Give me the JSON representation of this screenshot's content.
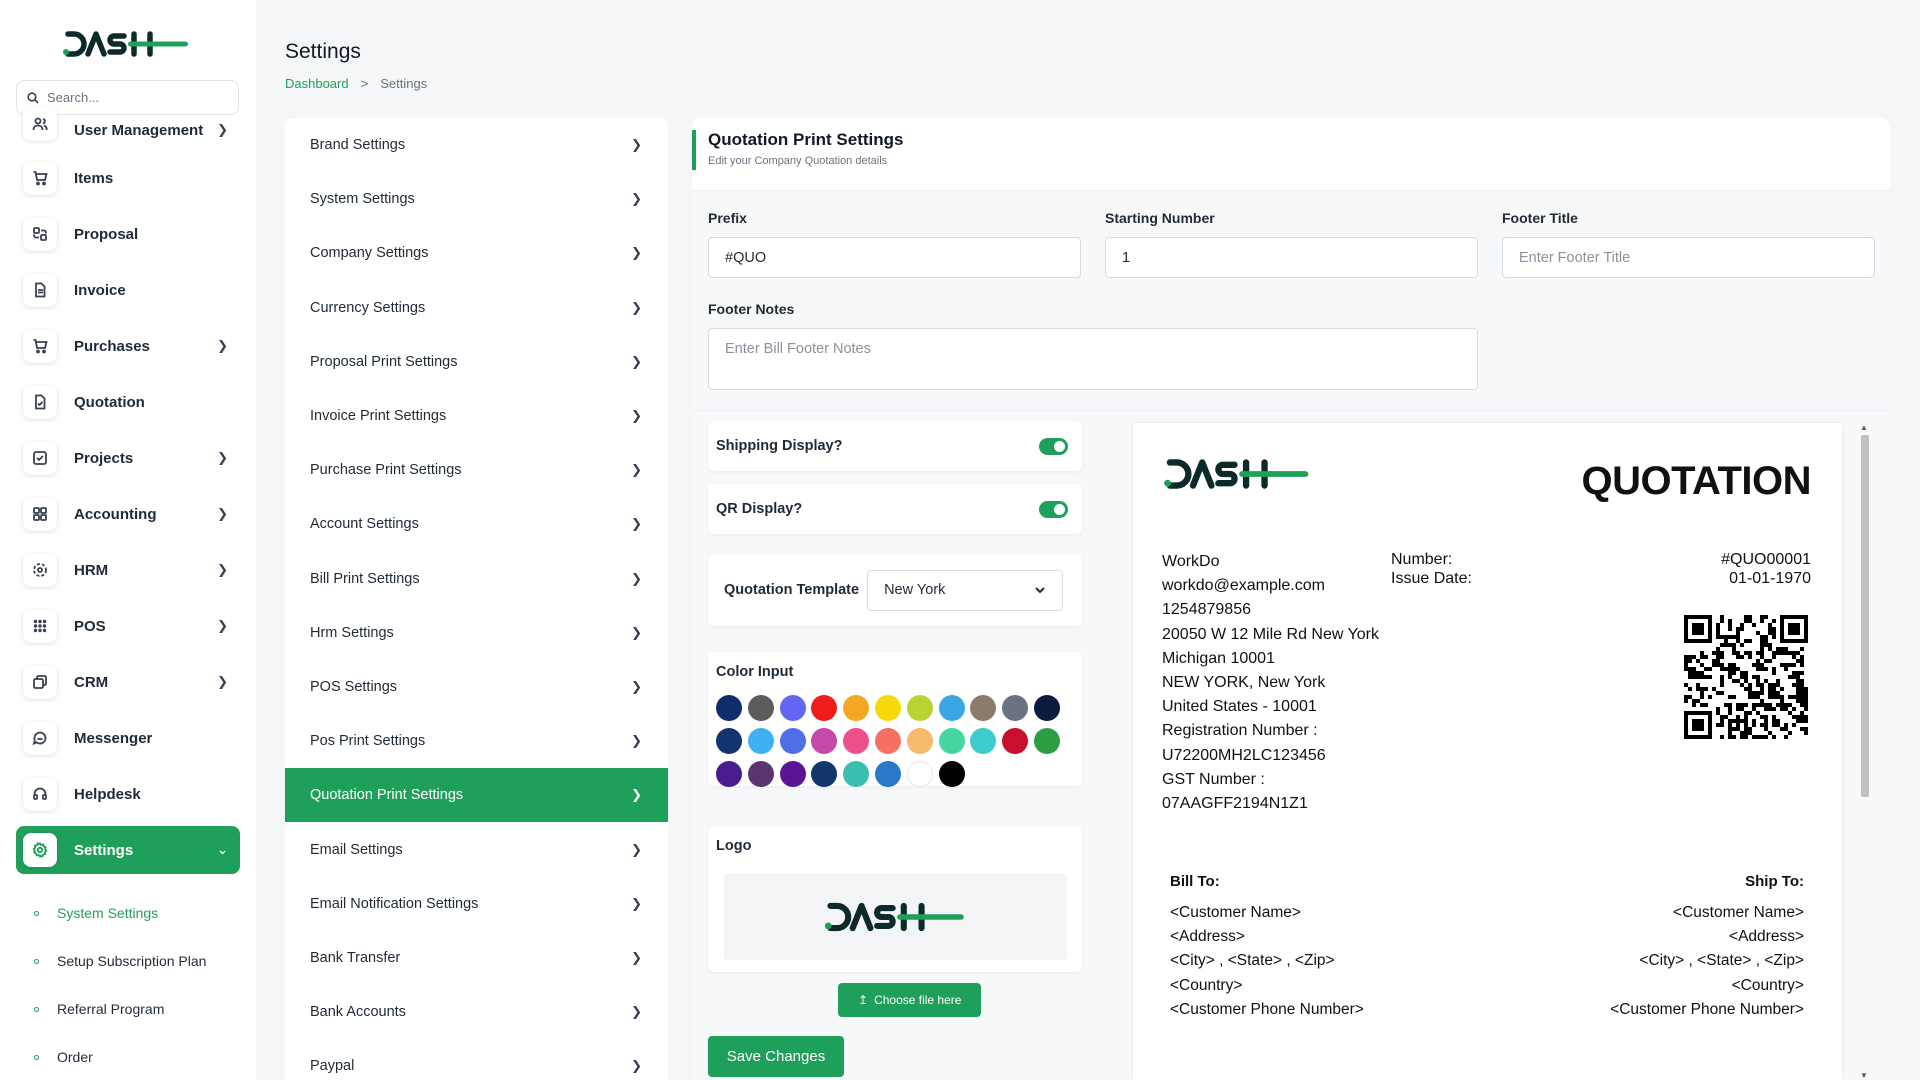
{
  "sidebar": {
    "search_placeholder": "Search...",
    "items": [
      {
        "label": "User Management",
        "icon": "users-icon",
        "chevron": true
      },
      {
        "label": "Items",
        "icon": "cart-icon",
        "chevron": false
      },
      {
        "label": "Proposal",
        "icon": "proposal-icon",
        "chevron": false
      },
      {
        "label": "Invoice",
        "icon": "invoice-icon",
        "chevron": false
      },
      {
        "label": "Purchases",
        "icon": "purchase-cart-icon",
        "chevron": true
      },
      {
        "label": "Quotation",
        "icon": "quotation-icon",
        "chevron": false
      },
      {
        "label": "Projects",
        "icon": "projects-icon",
        "chevron": true
      },
      {
        "label": "Accounting",
        "icon": "accounting-icon",
        "chevron": true
      },
      {
        "label": "HRM",
        "icon": "hrm-icon",
        "chevron": true
      },
      {
        "label": "POS",
        "icon": "grid-dots-icon",
        "chevron": true
      },
      {
        "label": "CRM",
        "icon": "crm-icon",
        "chevron": true
      },
      {
        "label": "Messenger",
        "icon": "chat-icon",
        "chevron": false
      },
      {
        "label": "Helpdesk",
        "icon": "headset-icon",
        "chevron": false
      }
    ],
    "active_item": {
      "label": "Settings",
      "icon": "gear-icon"
    },
    "sub_items": [
      "System Settings",
      "Setup Subscription Plan",
      "Referral Program",
      "Order"
    ]
  },
  "header": {
    "title": "Settings",
    "breadcrumb": {
      "link": "Dashboard",
      "separator": ">",
      "current": "Settings"
    }
  },
  "settings_menu": {
    "items": [
      "Brand Settings",
      "System Settings",
      "Company Settings",
      "Currency Settings",
      "Proposal Print Settings",
      "Invoice Print Settings",
      "Purchase Print Settings",
      "Account Settings",
      "Bill Print Settings",
      "Hrm Settings",
      "POS Settings",
      "Pos Print Settings",
      "Quotation Print Settings",
      "Email Settings",
      "Email Notification Settings",
      "Bank Transfer",
      "Bank Accounts",
      "Paypal"
    ],
    "active_index": 12,
    "arrow": ">"
  },
  "card": {
    "title": "Quotation Print Settings",
    "subtitle": "Edit your Company Quotation details",
    "prefix": {
      "label": "Prefix",
      "value": "#QUO"
    },
    "starting_number": {
      "label": "Starting Number",
      "value": "1"
    },
    "footer_title": {
      "label": "Footer Title",
      "placeholder": "Enter Footer Title"
    },
    "footer_notes": {
      "label": "Footer Notes",
      "placeholder": "Enter Bill Footer Notes"
    },
    "shipping_display": {
      "label": "Shipping Display?",
      "on": true
    },
    "qr_display": {
      "label": "QR Display?",
      "on": true
    },
    "template": {
      "label": "Quotation Template",
      "value": "New York"
    },
    "color_input": {
      "label": "Color Input",
      "colors": [
        "#0f2d6b",
        "#5c5c5c",
        "#6366f1",
        "#ef1c1c",
        "#f5a623",
        "#f5d90a",
        "#b8d432",
        "#3ba6e6",
        "#8b7b6b",
        "#6b7280",
        "#0b1a3f",
        "#12356f",
        "#3db1f2",
        "#4f6ee8",
        "#c549a8",
        "#f0508a",
        "#f57062",
        "#f7b96a",
        "#45d6a0",
        "#3ecccc",
        "#c8102e",
        "#2e9e44",
        "#4a1d8f",
        "#5a3670",
        "#5a1494",
        "#12386b",
        "#39bfb0",
        "#2b78c9",
        "#ffffff",
        "#000000"
      ]
    },
    "logo": {
      "label": "Logo",
      "button": "Choose file here"
    },
    "save_button": "Save Changes"
  },
  "preview": {
    "title": "QUOTATION",
    "company_lines": [
      "WorkDo",
      "workdo@example.com",
      "1254879856",
      "20050 W 12 Mile Rd New York",
      "Michigan 10001",
      "NEW YORK, New York",
      "United States - 10001",
      "Registration Number :",
      "U72200MH2LC123456",
      "GST Number :",
      "07AAGFF2194N1Z1"
    ],
    "number_label": "Number:",
    "number_value": "#QUO00001",
    "issue_label": "Issue Date:",
    "issue_value": "01-01-1970",
    "bill_to": {
      "title": "Bill To:",
      "lines": [
        "<Customer Name>",
        "<Address>",
        "<City> , <State> , <Zip>",
        "<Country>",
        "<Customer Phone Number>"
      ]
    },
    "ship_to": {
      "title": "Ship To:",
      "lines": [
        "<Customer Name>",
        "<Address>",
        "<City> , <State> , <Zip>",
        "<Country>",
        "<Customer Phone Number>"
      ]
    }
  },
  "colors": {
    "accent": "#1fa05a",
    "logo_dark": "#0d2a2a"
  }
}
